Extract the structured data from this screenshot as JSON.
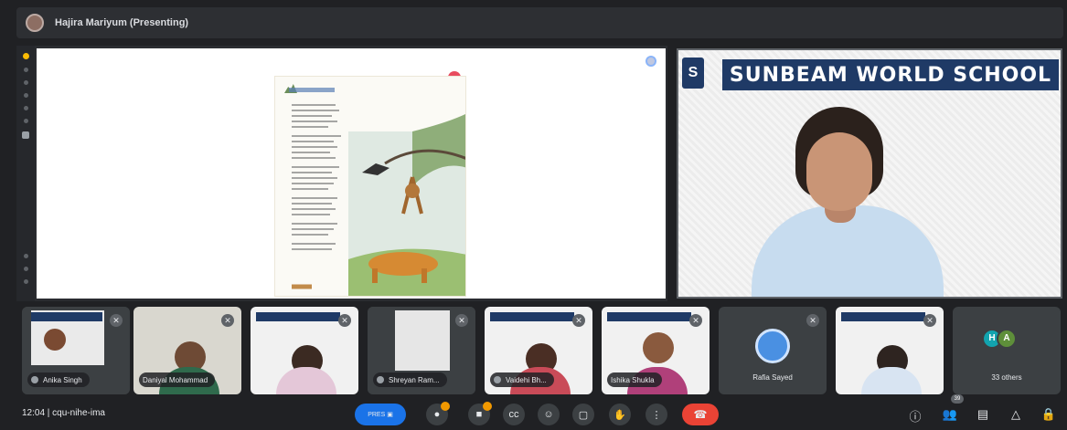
{
  "topbar": {
    "presenter_title": "Hajira Mariyum (Presenting)"
  },
  "speaker": {
    "banner": "SUNBEAM WORLD SCHOOL",
    "logo": "S"
  },
  "participants": [
    {
      "name": "Anika Singh",
      "style": "pill"
    },
    {
      "name": "Daniyal Mohammad",
      "style": "pill"
    },
    {
      "name": "",
      "style": "none"
    },
    {
      "name": "Shreyan Ram...",
      "style": "pill"
    },
    {
      "name": "Vaidehi Bh...",
      "style": "pill"
    },
    {
      "name": "Ishika Shukla",
      "style": "pill"
    },
    {
      "name": "Rafia Sayed",
      "style": "plain"
    },
    {
      "name": "",
      "style": "none"
    },
    {
      "name": "33 others",
      "style": "plain"
    }
  ],
  "others_avatars": [
    "H",
    "A"
  ],
  "bottombar": {
    "time_text": "12:04 | cqu-nihe-ima",
    "present_label": "PRES",
    "participant_count": "39"
  },
  "icons": {
    "mic": "mic-icon",
    "camera": "camera-icon",
    "captions": "captions-icon",
    "emoji": "emoji-icon",
    "present": "present-icon",
    "raise_hand": "raise-hand-icon",
    "more": "more-icon",
    "end_call": "end-call-icon",
    "info": "info-icon",
    "people": "people-icon",
    "chat": "chat-icon",
    "activities": "activities-icon",
    "lock": "lock-icon"
  },
  "colors": {
    "background": "#202124",
    "end_call": "#ea4335",
    "accent": "#1a73e8",
    "banner": "#1f3a66"
  }
}
